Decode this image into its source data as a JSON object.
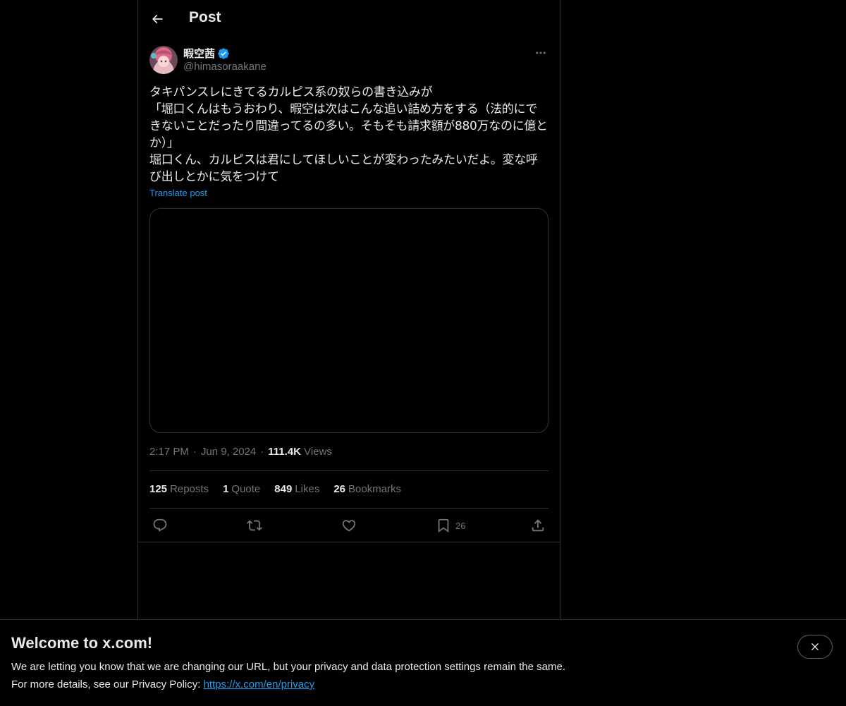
{
  "header": {
    "title": "Post"
  },
  "author": {
    "display_name": "暇空茜",
    "handle": "@himasoraakane"
  },
  "post": {
    "text": "タキパンスレにきてるカルピス系の奴らの書き込みが\n「堀口くんはもうおわり、暇空は次はこんな追い詰め方をする（法的にできないことだったり間違ってるの多い。そもそも請求額が880万なのに億とか）」\n堀口くん、カルピスは君にしてほしいことが変わったみたいだよ。変な呼び出しとかに気をつけて",
    "translate_label": "Translate post"
  },
  "meta": {
    "time": "2:17 PM",
    "date": "Jun 9, 2024",
    "views_count": "111.4K",
    "views_label": "Views"
  },
  "stats": {
    "reposts_count": "125",
    "reposts_label": "Reposts",
    "quotes_count": "1",
    "quotes_label": "Quote",
    "likes_count": "849",
    "likes_label": "Likes",
    "bookmarks_count": "26",
    "bookmarks_label": "Bookmarks"
  },
  "actions": {
    "bookmark_count": "26"
  },
  "banner": {
    "title": "Welcome to x.com!",
    "line1": "We are letting you know that we are changing our URL, but your privacy and data protection settings remain the same.",
    "line2_prefix": "For more details, see our Privacy Policy: ",
    "link": "https://x.com/en/privacy"
  },
  "colors": {
    "background": "#000000",
    "text": "#e7e9ea",
    "secondary": "#71767b",
    "accent": "#1d9bf0",
    "border": "#2f3336"
  },
  "icons": [
    "back-arrow-icon",
    "verified-badge-icon",
    "more-icon",
    "reply-icon",
    "repost-icon",
    "like-icon",
    "bookmark-icon",
    "share-icon",
    "close-icon"
  ]
}
